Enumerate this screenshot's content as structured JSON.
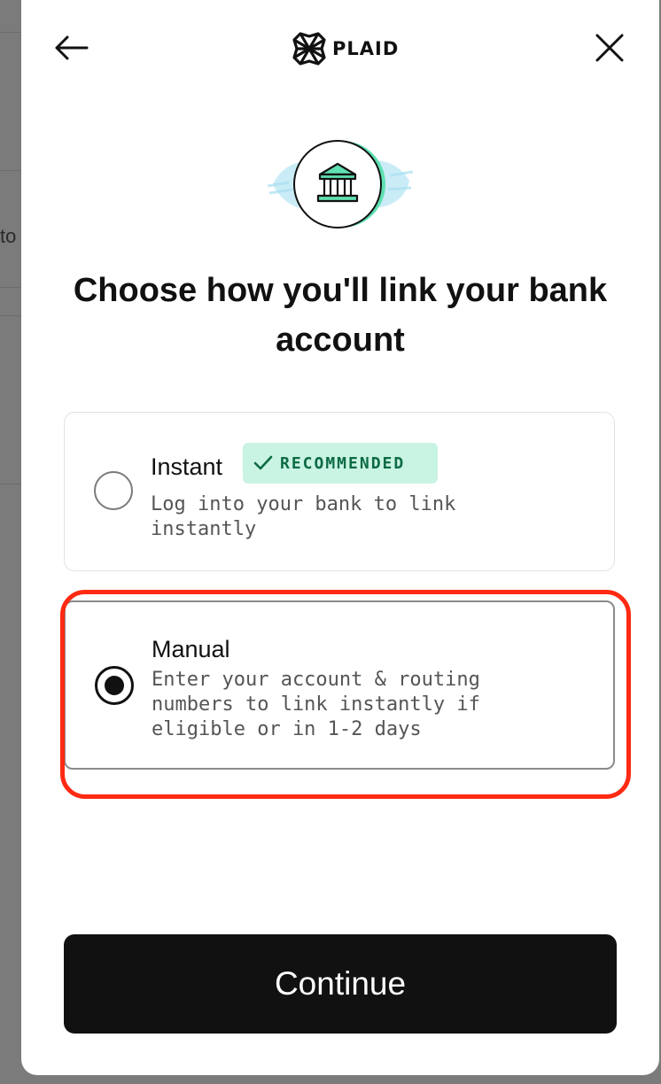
{
  "backdrop": {
    "peek_text": "to"
  },
  "header": {
    "back_icon": "arrow-left-icon",
    "close_icon": "close-icon",
    "logo_text": "PLAID",
    "logo_icon": "plaid-logo-icon"
  },
  "hero": {
    "icon": "bank-icon",
    "accent_color": "#5fe0b1",
    "splash_color": "#a9dff0"
  },
  "title": "Choose how you'll link your bank account",
  "options": [
    {
      "label": "Instant",
      "badge": "RECOMMENDED",
      "badge_icon": "check-icon",
      "description": "Log into your bank to link instantly",
      "selected": false
    },
    {
      "label": "Manual",
      "description": "Enter your account & routing numbers to link instantly if eligible or in 1-2 days",
      "selected": true
    }
  ],
  "annotation": {
    "highlight_color": "#ff2a12"
  },
  "continue_button": {
    "label": "Continue"
  }
}
